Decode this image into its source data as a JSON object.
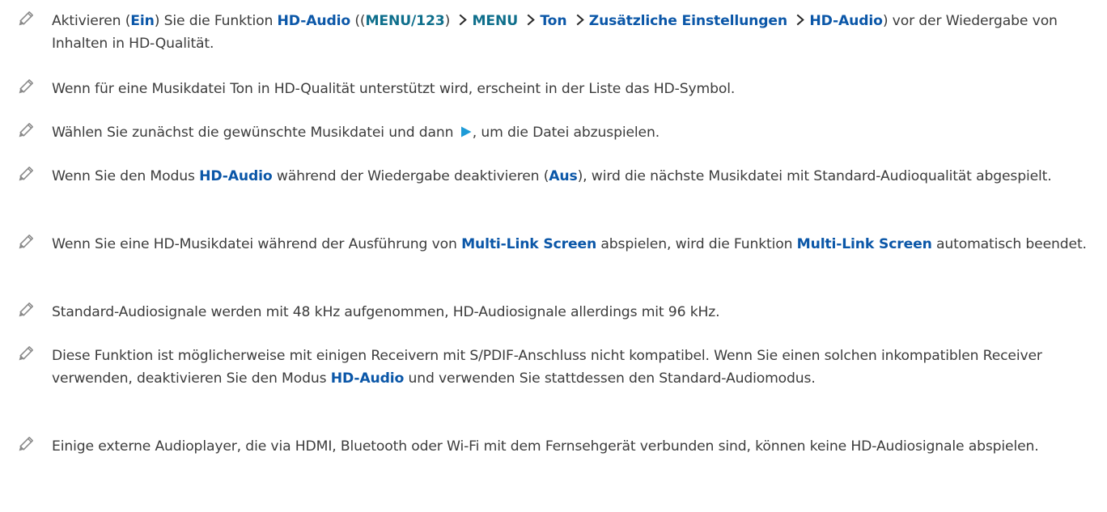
{
  "notes": [
    {
      "parts": [
        {
          "t": "Aktivieren ("
        },
        {
          "t": "Ein",
          "hl": true
        },
        {
          "t": ") Sie die Funktion "
        },
        {
          "t": "HD-Audio",
          "hl": true
        },
        {
          "t": " (("
        },
        {
          "t": "MENU/123",
          "hl": true,
          "teal": true
        },
        {
          "t": ") "
        },
        {
          "icon": "chevron-right-icon"
        },
        {
          "t": "MENU",
          "hl": true,
          "teal": true
        },
        {
          "t": " "
        },
        {
          "icon": "chevron-right-icon"
        },
        {
          "t": "Ton",
          "hl": true
        },
        {
          "t": " "
        },
        {
          "icon": "chevron-right-icon"
        },
        {
          "t": "Zusätzliche Einstellungen",
          "hl": true
        },
        {
          "t": " "
        },
        {
          "icon": "chevron-right-icon"
        },
        {
          "t": "HD-Audio",
          "hl": true
        },
        {
          "t": ") vor der Wiedergabe von Inhalten in HD-Qualität."
        }
      ]
    },
    {
      "parts": [
        {
          "t": "Wenn für eine Musikdatei Ton in HD-Qualität unterstützt wird, erscheint in der Liste das HD-Symbol."
        }
      ]
    },
    {
      "parts": [
        {
          "t": "Wählen Sie zunächst die gewünschte Musikdatei und dann "
        },
        {
          "icon": "play-icon"
        },
        {
          "t": ", um die Datei abzuspielen."
        }
      ]
    },
    {
      "parts": [
        {
          "t": "Wenn Sie den Modus "
        },
        {
          "t": "HD-Audio",
          "hl": true
        },
        {
          "t": " während der Wiedergabe deaktivieren ("
        },
        {
          "t": "Aus",
          "hl": true
        },
        {
          "t": "), wird die nächste Musikdatei mit Standard-Audioqualität abgespielt."
        }
      ]
    },
    {
      "parts": [
        {
          "t": "Wenn Sie eine HD-Musikdatei während der Ausführung von "
        },
        {
          "t": "Multi-Link Screen",
          "hl": true
        },
        {
          "t": " abspielen, wird die Funktion "
        },
        {
          "t": "Multi-Link Screen",
          "hl": true
        },
        {
          "t": " automatisch beendet."
        }
      ]
    },
    {
      "parts": [
        {
          "t": "Standard-Audiosignale werden mit 48 kHz aufgenommen, HD-Audiosignale allerdings mit 96 kHz."
        }
      ]
    },
    {
      "parts": [
        {
          "t": "Diese Funktion ist möglicherweise mit einigen Receivern mit S/PDIF-Anschluss nicht kompatibel. Wenn Sie einen solchen inkompatiblen Receiver verwenden, deaktivieren Sie den Modus "
        },
        {
          "t": "HD-Audio",
          "hl": true
        },
        {
          "t": " und verwenden Sie stattdessen den Standard-Audiomodus."
        }
      ]
    },
    {
      "parts": [
        {
          "t": "Einige externe Audioplayer, die via HDMI, Bluetooth oder Wi-Fi mit dem Fernsehgerät verbunden sind, können keine HD-Audiosignale abspielen."
        }
      ]
    }
  ],
  "icons": {
    "note": "pencil-icon",
    "chevron": "chevron-right-icon",
    "play": "play-icon"
  },
  "colors": {
    "text": "#3c3c3c",
    "highlight": "#0b57a8",
    "highlight_teal": "#0f6f8c",
    "pencil": "#8a8a8a",
    "play": "#1d9bd7"
  }
}
